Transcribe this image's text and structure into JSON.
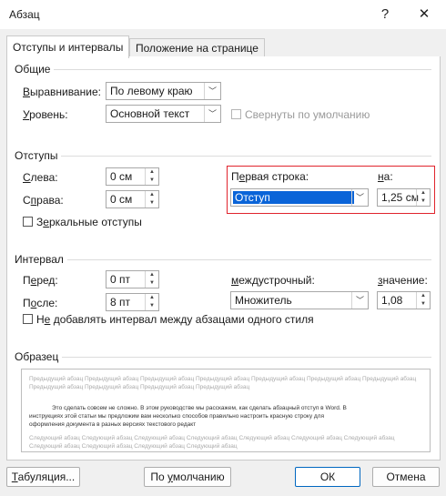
{
  "window": {
    "title": "Абзац",
    "help": "?",
    "close": "✕"
  },
  "tabs": [
    {
      "label": "Отступы и интервалы",
      "active": true
    },
    {
      "label": "Положение на странице",
      "active": false
    }
  ],
  "general": {
    "section": "Общие",
    "alignment_label_u": "В",
    "alignment_label_rest": "ыравнивание:",
    "alignment_value": "По левому краю",
    "level_label_u": "У",
    "level_label_rest": "ровень:",
    "level_value": "Основной текст",
    "collapsed_label": "Свернуты по умолчанию"
  },
  "indents": {
    "section": "Отступы",
    "left_label_u": "С",
    "left_label_rest": "лева:",
    "left_value": "0 см",
    "right_label_pre": "С",
    "right_label_u": "п",
    "right_label_rest": "рава:",
    "right_value": "0 см",
    "mirror_label_pre": "З",
    "mirror_label_u": "е",
    "mirror_label_rest": "ркальные отступы",
    "first_line_label_pre": "П",
    "first_line_label_u": "е",
    "first_line_label_rest": "рвая строка:",
    "first_line_value": "Отступ",
    "by_label_u": "н",
    "by_label_rest": "а:",
    "by_value": "1,25 см"
  },
  "spacing": {
    "section": "Интервал",
    "before_label_pre": "П",
    "before_label_u": "е",
    "before_label_rest": "ред:",
    "before_value": "0 пт",
    "after_label_pre": "П",
    "after_label_u": "о",
    "after_label_rest": "сле:",
    "after_value": "8 пт",
    "line_label_u": "м",
    "line_label_rest": "еждустрочный:",
    "line_value": "Множитель",
    "value_label_u": "з",
    "value_label_rest": "начение:",
    "value_value": "1,08",
    "dont_add_pre": "Н",
    "dont_add_u": "е",
    "dont_add_rest": " добавлять интервал между абзацами одного стиля"
  },
  "preview": {
    "section": "Образец",
    "prev_line": "Предыдущий абзац Предыдущий абзац Предыдущий абзац Предыдущий абзац Предыдущий абзац Предыдущий абзац Предыдущий абзац Предыдущий абзац Предыдущий абзац Предыдущий абзац Предыдущий абзац",
    "body_1": "Это сделать совсем не сложно. В этом руководстве мы расскажем, как сделать абзацный отступ в Word. В",
    "body_2": "инструкциях этой статьи мы предложим вам несколько способов правильно настроить красную строку для",
    "body_3": "оформления документа в разных версиях текстового редакт",
    "next_line": "Следующий абзац Следующий абзац Следующий абзац Следующий абзац Следующий абзац Следующий абзац Следующий абзац Следующий абзац Следующий абзац Следующий абзац Следующий абзац"
  },
  "buttons": {
    "tabs_u": "Т",
    "tabs_rest": "абуляция...",
    "default_pre": "По ",
    "default_u": "у",
    "default_rest": "молчанию",
    "ok": "ОК",
    "cancel": "Отмена"
  }
}
